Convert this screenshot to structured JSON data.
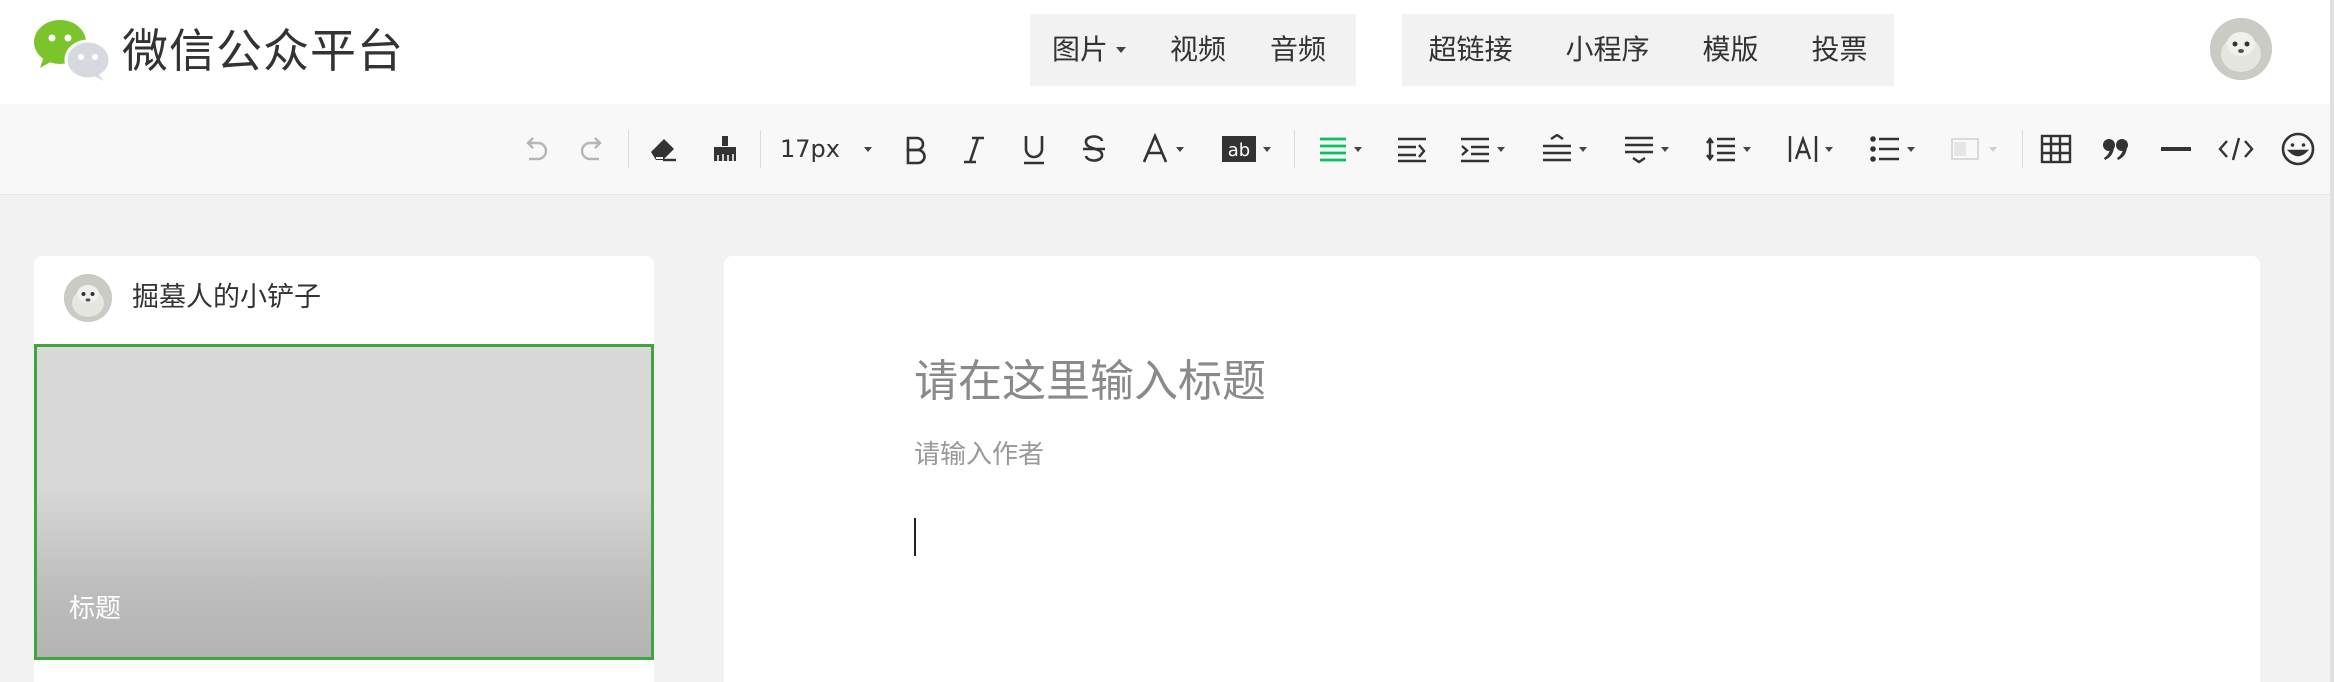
{
  "header": {
    "brand": "微信公众平台",
    "media_group": [
      {
        "label": "图片",
        "dropdown": true
      },
      {
        "label": "视频",
        "dropdown": false
      },
      {
        "label": "音频",
        "dropdown": false
      }
    ],
    "insert_group": [
      {
        "label": "超链接"
      },
      {
        "label": "小程序"
      },
      {
        "label": "模版"
      },
      {
        "label": "投票"
      }
    ],
    "user_avatar_icon": "user-avatar"
  },
  "toolbar": {
    "font_size": "17px",
    "items": [
      "undo-icon",
      "redo-icon",
      "eraser-icon",
      "format-brush-icon",
      "font-size-select",
      "bold-icon",
      "italic-icon",
      "underline-icon",
      "strikethrough-icon",
      "font-color-icon",
      "background-color-icon",
      "align-icon",
      "indent-icon",
      "first-line-indent-icon",
      "paragraph-spacing-before-icon",
      "paragraph-spacing-after-icon",
      "line-height-icon",
      "letter-spacing-icon",
      "list-icon",
      "disabled-format-icon",
      "table-icon",
      "quote-icon",
      "horizontal-rule-icon",
      "code-icon",
      "emoji-icon"
    ],
    "active_color": "#07c160"
  },
  "article_list": {
    "account_name": "掘墓人的小铲子",
    "cover_title": "标题",
    "selected_border_color": "#3fa63f"
  },
  "editor": {
    "title_placeholder": "请在这里输入标题",
    "author_placeholder": "请输入作者"
  }
}
